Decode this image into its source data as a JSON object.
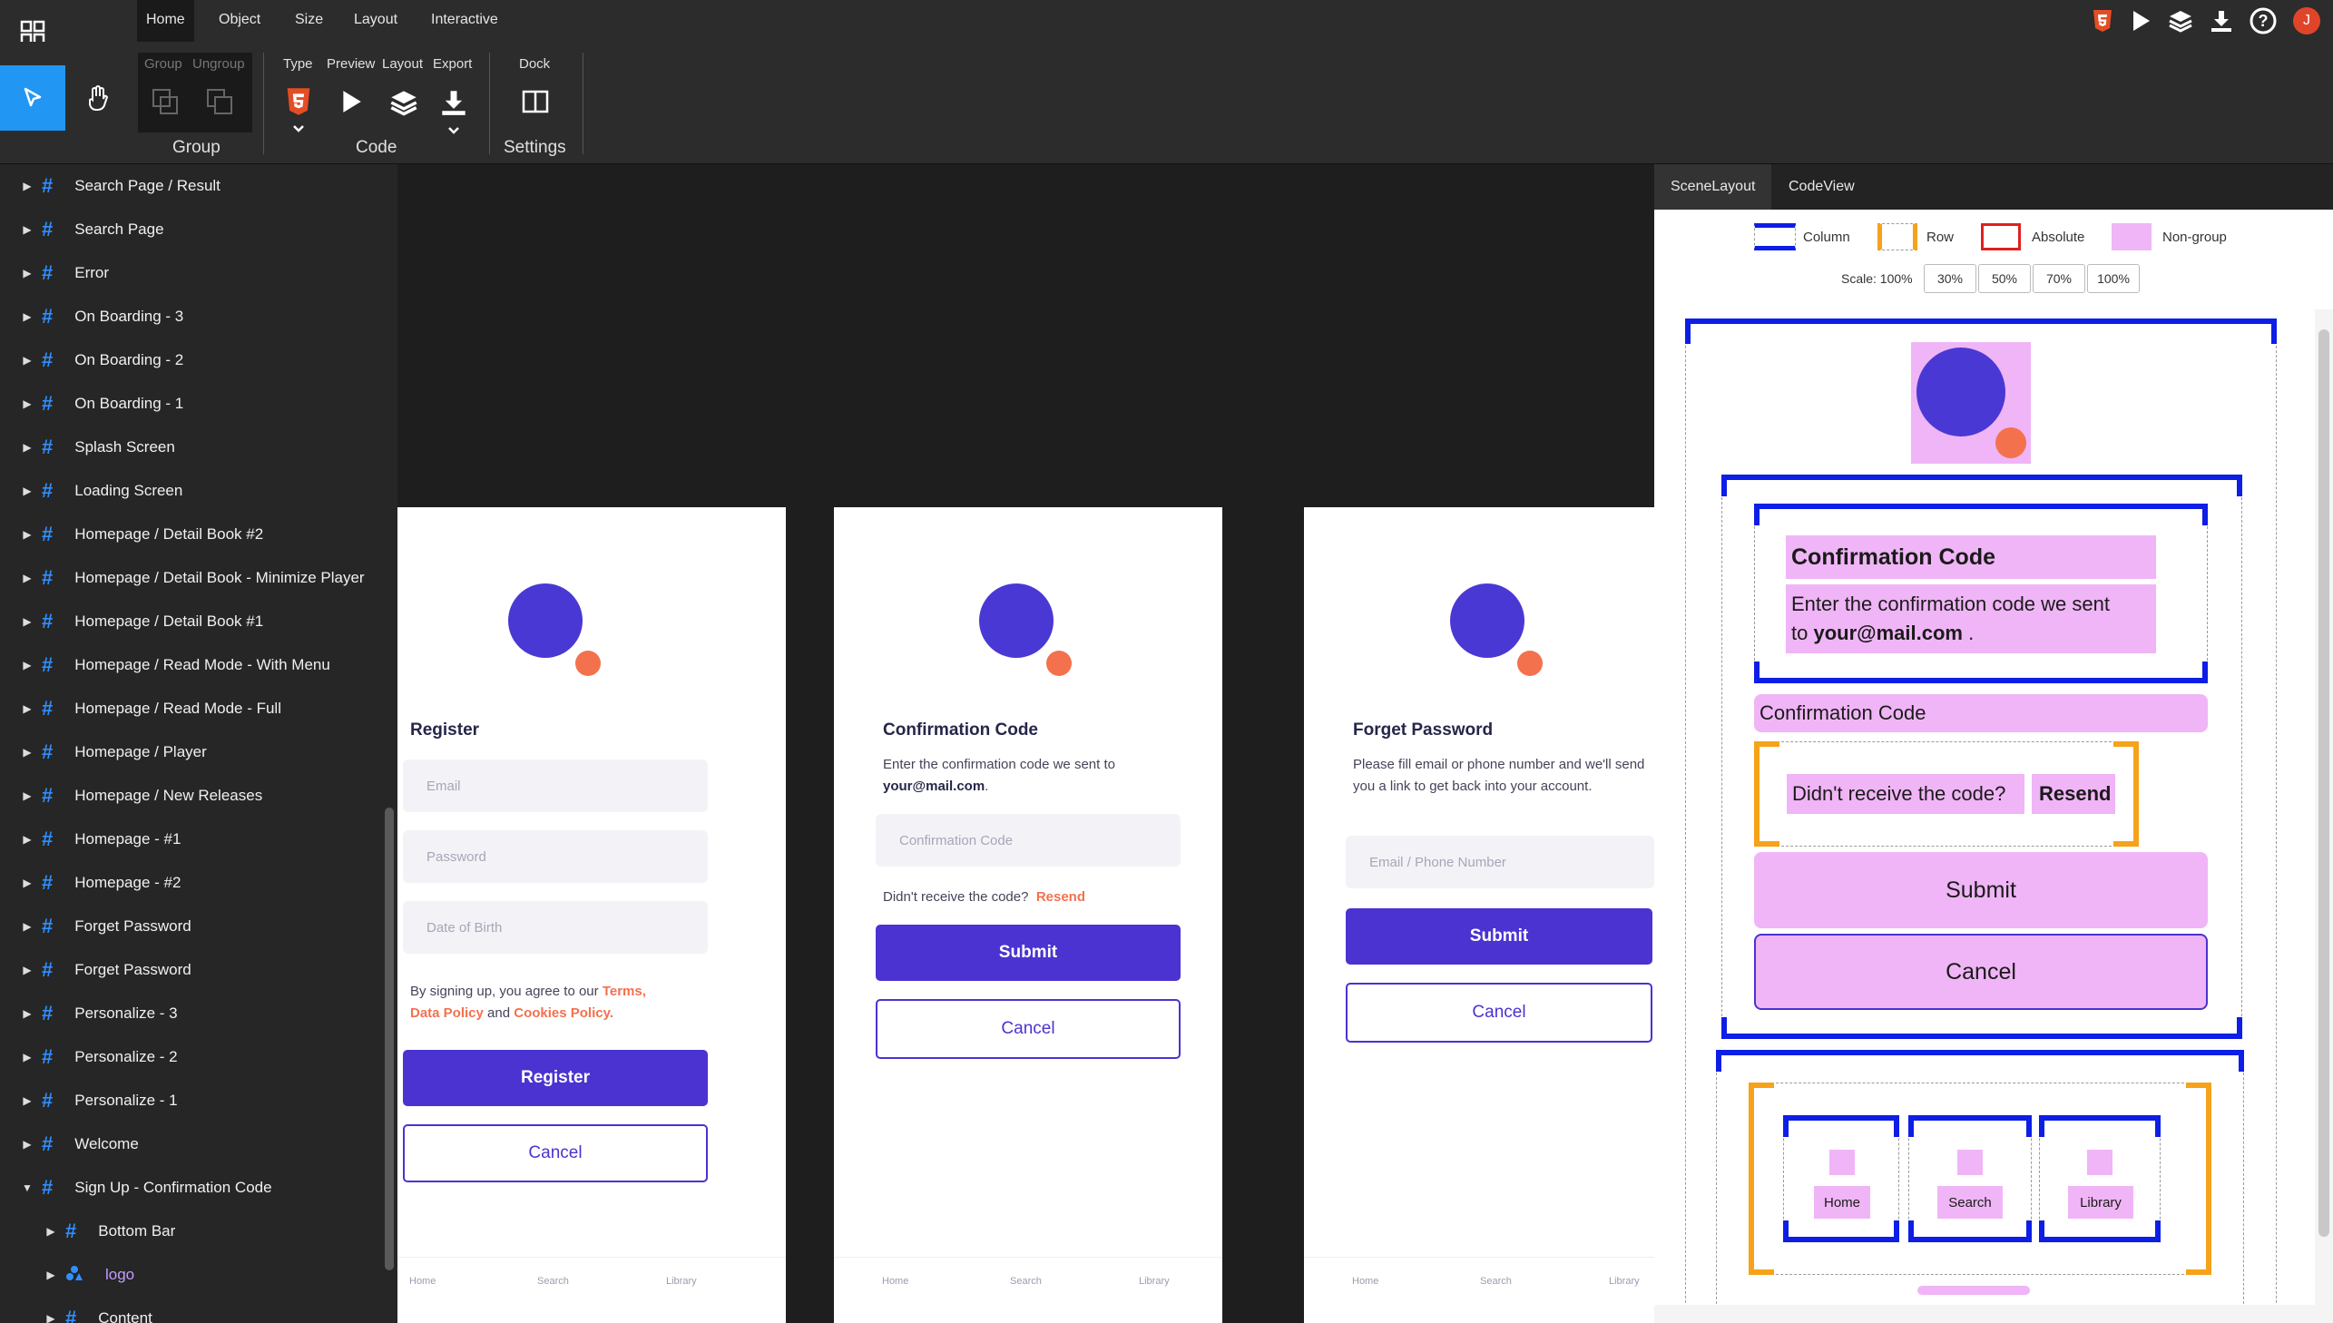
{
  "menu": {
    "tabs": [
      "Home",
      "Object",
      "Size",
      "Layout",
      "Interactive"
    ]
  },
  "ribbon": {
    "group_labels": [
      "Group",
      "Ungroup"
    ],
    "group_title": "Group",
    "code_labels": [
      "Type",
      "Preview",
      "Layout",
      "Export"
    ],
    "code_title": "Code",
    "settings_labels": [
      "Dock"
    ],
    "settings_title": "Settings"
  },
  "user": {
    "initial": "J",
    "avatar_color": "#e0452a"
  },
  "layers": [
    {
      "label": "Search Page / Result",
      "expanded": false
    },
    {
      "label": "Search Page",
      "expanded": false
    },
    {
      "label": "Error",
      "expanded": false
    },
    {
      "label": "On Boarding - 3",
      "expanded": false
    },
    {
      "label": "On Boarding - 2",
      "expanded": false
    },
    {
      "label": "On Boarding - 1",
      "expanded": false
    },
    {
      "label": "Splash Screen",
      "expanded": false
    },
    {
      "label": "Loading Screen",
      "expanded": false
    },
    {
      "label": "Homepage / Detail Book #2",
      "expanded": false
    },
    {
      "label": "Homepage / Detail Book - Minimize Player",
      "expanded": false
    },
    {
      "label": "Homepage / Detail Book #1",
      "expanded": false
    },
    {
      "label": "Homepage / Read Mode - With Menu",
      "expanded": false
    },
    {
      "label": "Homepage / Read Mode - Full",
      "expanded": false
    },
    {
      "label": "Homepage / Player",
      "expanded": false
    },
    {
      "label": "Homepage / New Releases",
      "expanded": false
    },
    {
      "label": "Homepage - #1",
      "expanded": false
    },
    {
      "label": "Homepage - #2",
      "expanded": false
    },
    {
      "label": "Forget Password",
      "expanded": false
    },
    {
      "label": "Forget Password",
      "expanded": false
    },
    {
      "label": "Personalize - 3",
      "expanded": false
    },
    {
      "label": "Personalize - 2",
      "expanded": false
    },
    {
      "label": "Personalize - 1",
      "expanded": false
    },
    {
      "label": "Welcome",
      "expanded": false
    },
    {
      "label": "Sign Up - Confirmation Code",
      "expanded": true
    },
    {
      "label": "Bottom Bar",
      "expanded": false,
      "child": true
    },
    {
      "label": "logo",
      "expanded": false,
      "child": true,
      "kind": "component"
    },
    {
      "label": "Content",
      "expanded": false,
      "child": true
    }
  ],
  "screens": {
    "register": {
      "title": "Register",
      "email_ph": "Email",
      "password_ph": "Password",
      "dob_ph": "Date of Birth",
      "terms_pre": "By signing up, you agree to our ",
      "terms": "Terms,",
      "data_policy": "Data Policy",
      "and": " and ",
      "cookies": "Cookies Policy.",
      "primary": "Register",
      "cancel": "Cancel"
    },
    "confirm": {
      "title": "Confirmation Code",
      "text": "Enter the confirmation code we sent to",
      "email": "your@mail.com",
      "dot": ".",
      "input_ph": "Confirmation Code",
      "resend_q": "Didn't receive the code?",
      "resend": "Resend",
      "primary": "Submit",
      "cancel": "Cancel"
    },
    "forget": {
      "title": "Forget Password",
      "text": "Please fill email or phone number and we'll send you a link to get back into your account.",
      "input_ph": "Email / Phone Number",
      "primary": "Submit",
      "cancel": "Cancel"
    },
    "nav": [
      "Home",
      "Search",
      "Library"
    ]
  },
  "panel": {
    "tabs": [
      "SceneLayout",
      "CodeView"
    ],
    "legend": [
      "Column",
      "Row",
      "Absolute",
      "Non-group"
    ],
    "scale_label": "Scale: 100%",
    "scales": [
      "30%",
      "50%",
      "70%",
      "100%"
    ],
    "preview": {
      "title": "Confirmation Code",
      "text_pre": "Enter the confirmation code we sent",
      "text_to": "to",
      "email": "your@mail.com",
      "dot": " .",
      "input": "Confirmation Code",
      "resend_q": "Didn't receive the code?",
      "resend": "Resend",
      "submit": "Submit",
      "cancel": "Cancel",
      "nav": [
        "Home",
        "Search",
        "Library"
      ]
    }
  }
}
